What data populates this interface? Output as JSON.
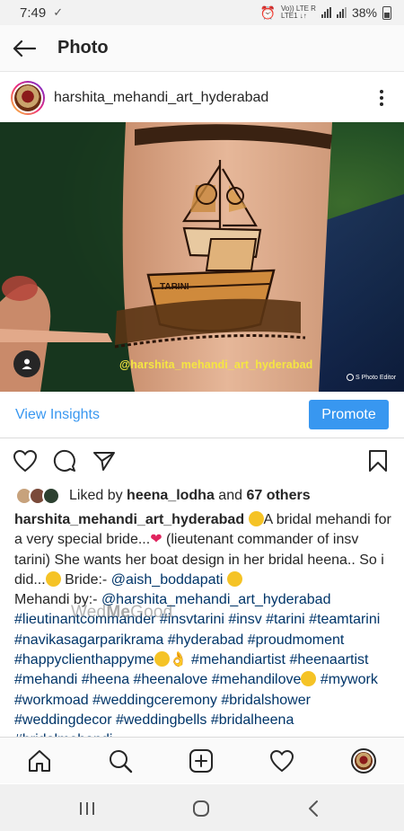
{
  "status_bar": {
    "time": "7:49",
    "network_top": "Vo)) LTE R",
    "network_bottom": "LTE1 ↓↑",
    "battery": "38%"
  },
  "top_bar": {
    "title": "Photo"
  },
  "post": {
    "username": "harshita_mehandi_art_hyderabad",
    "photo_watermark": "@harshita_mehandi_art_hyderabad",
    "photo_editor_mark": "S Photo Editor",
    "boat_label": "TARINI"
  },
  "insights": {
    "view_label": "View Insights",
    "promote_label": "Promote"
  },
  "likes": {
    "prefix": "Liked by ",
    "user": "heena_lodha",
    "middle": " and ",
    "others": "67 others"
  },
  "caption": {
    "username": "harshita_mehandi_art_hyderabad",
    "t1": "A bridal mehandi for a very special bride...",
    "t2": " (lieutenant commander of insv tarini) She wants her boat design in her bridal heena.. So i did...",
    "t3": " Bride:- ",
    "mention1": "@aish_boddapati",
    "t4": "Mehandi by:- ",
    "mention2": "@harshita_mehandi_art_hyderabad",
    "tags1": "#lieutinantcommander #insvtarini  #insv #tarini #teamtarini #navikasagarparikrama #hyderabad #proudmoment #happyclienthappyme",
    "tags2": "#mehandiartist #heenaartist #mehandi #heena #heenalove #mehandilove",
    "tags3": " #mywork #workmoad #weddingceremony #bridalshower #weddingdecor #weddingbells #bridalheena #bridalmehandi"
  },
  "overlay_watermark": {
    "part1": "Wed",
    "part2": "Me",
    "part3": "Good"
  },
  "colors": {
    "link_blue": "#3897f0",
    "hashtag": "#003569",
    "watermark_yellow": "#f5e642"
  },
  "icons": [
    "back-arrow-icon",
    "more-options-icon",
    "like-heart-icon",
    "comment-icon",
    "share-icon",
    "save-bookmark-icon",
    "home-icon",
    "search-icon",
    "add-post-icon",
    "activity-heart-icon",
    "recents-icon",
    "home-circle-icon",
    "back-chevron-icon"
  ]
}
